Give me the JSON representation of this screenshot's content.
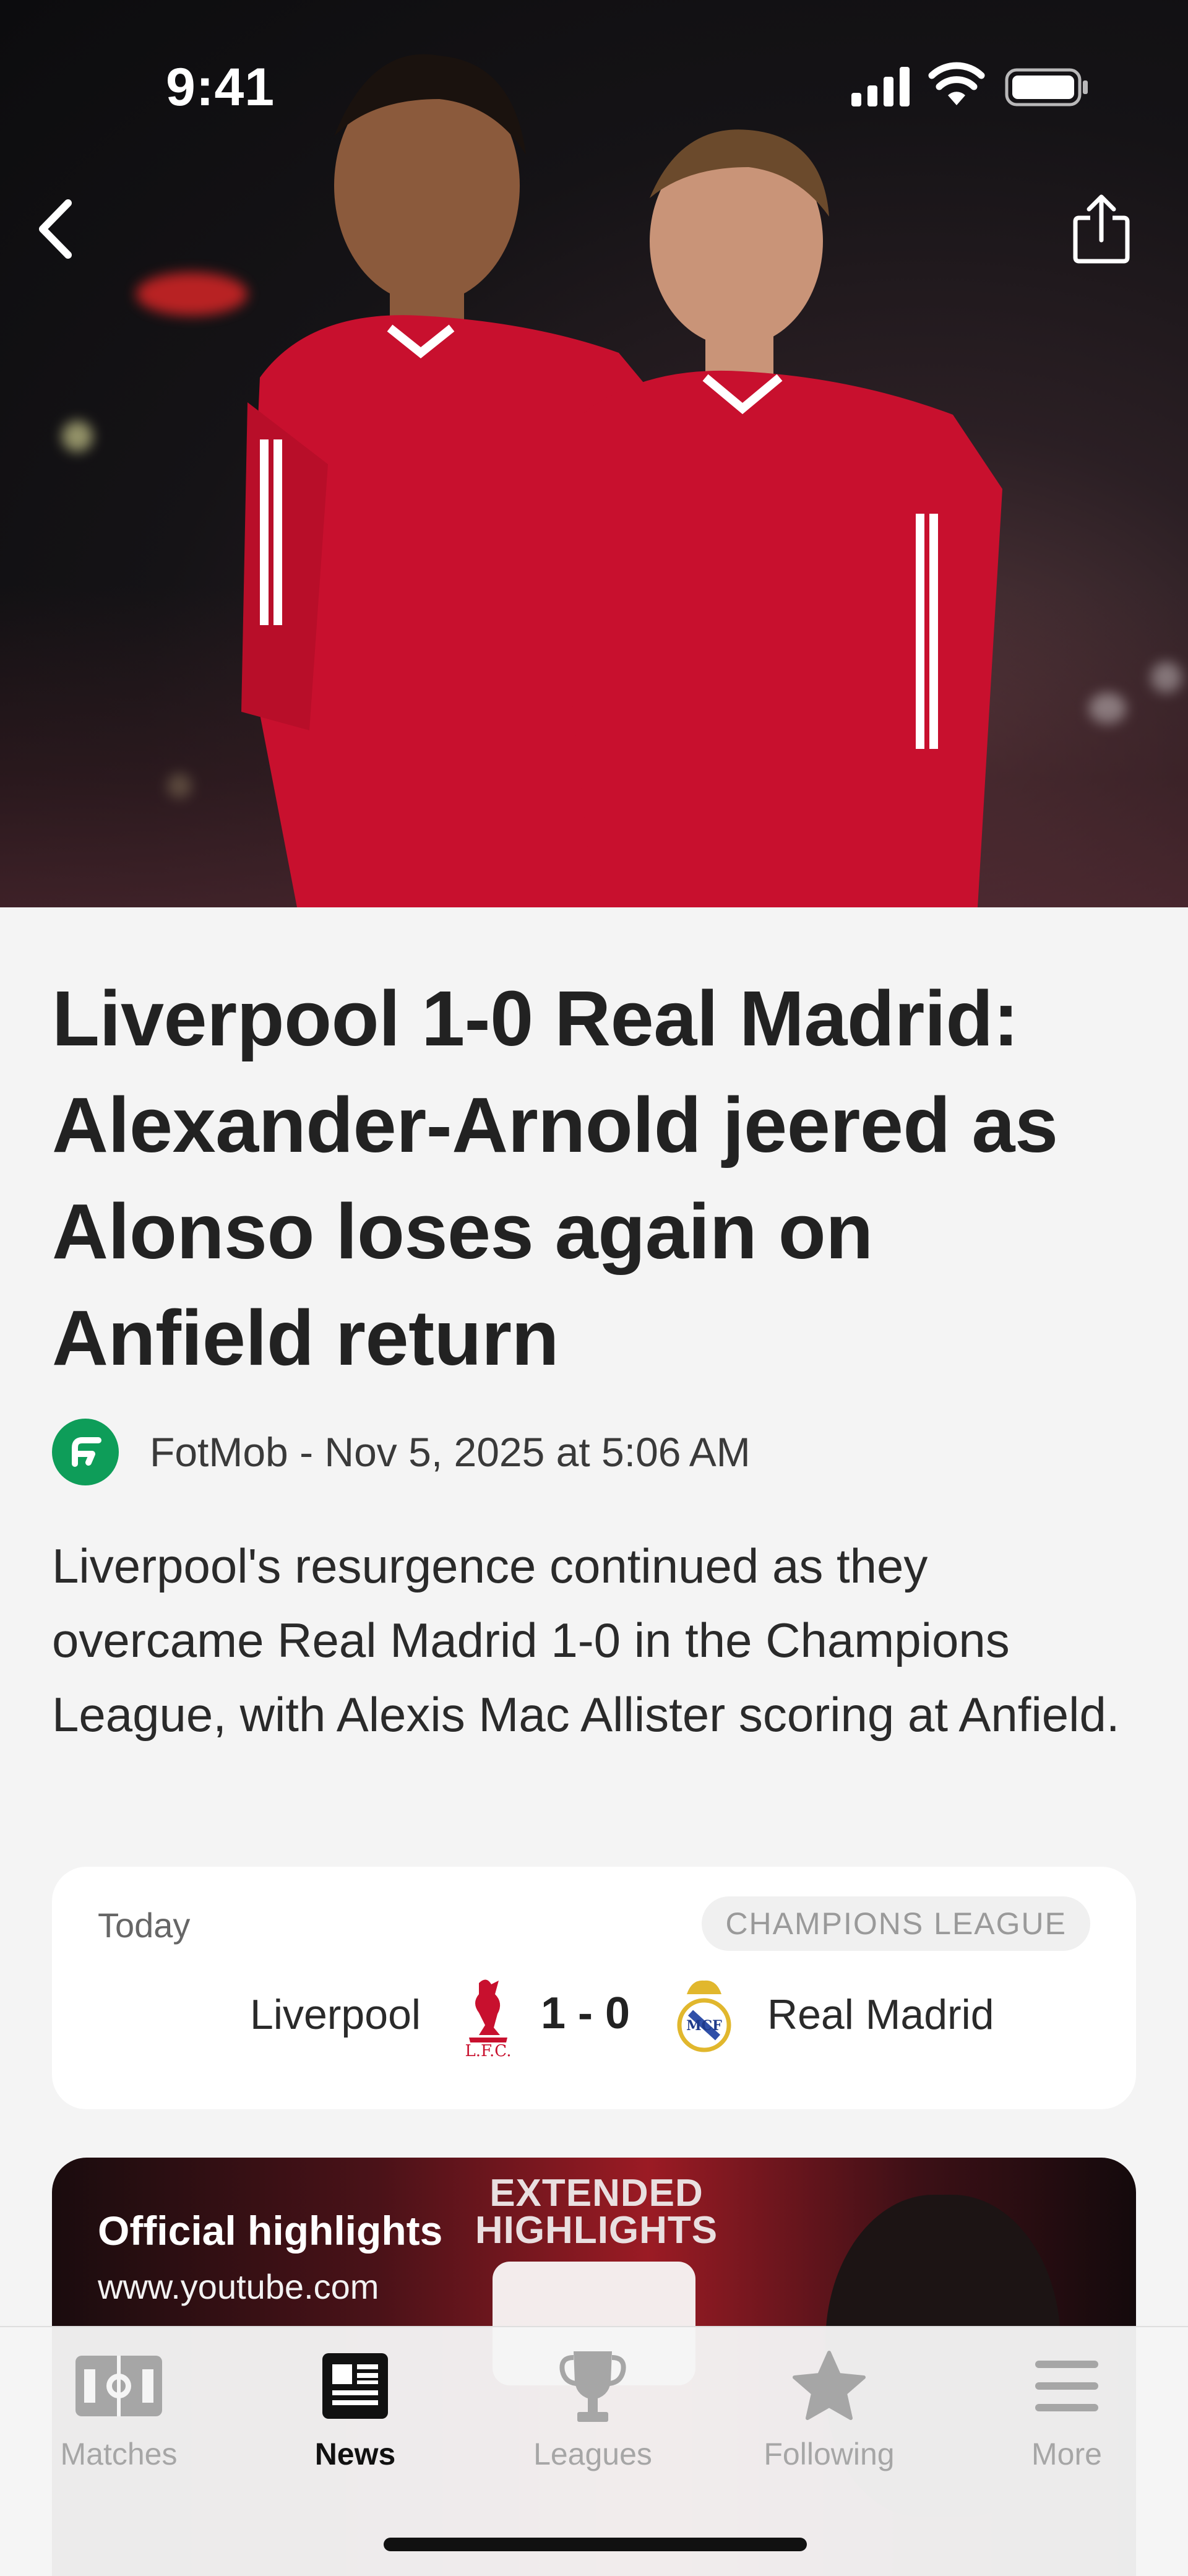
{
  "status_bar": {
    "time": "9:41"
  },
  "article": {
    "title": "Liverpool 1-0 Real Madrid: Alexander-Arnold jeered as Alonso loses again on Anfield return",
    "byline": "FotMob - Nov 5, 2025 at 5:06 AM",
    "summary": "Liverpool's resurgence continued as they overcame Real Madrid 1-0 in the Champions League, with Alexis Mac Allister scoring at Anfield."
  },
  "match": {
    "date": "Today",
    "league": "CHAMPIONS LEAGUE",
    "home_team": "Liverpool",
    "score": "1 - 0",
    "away_team": "Real Madrid",
    "home_crest_icon": "liverpool-crest-icon",
    "away_crest_icon": "real-madrid-crest-icon"
  },
  "video": {
    "title": "Official highlights",
    "source": "www.youtube.com",
    "overlay_text": "EXTENDED HIGHLIGHTS"
  },
  "tabs": [
    {
      "label": "Matches",
      "icon": "pitch-icon"
    },
    {
      "label": "News",
      "icon": "newspaper-icon",
      "active": true
    },
    {
      "label": "Leagues",
      "icon": "trophy-icon"
    },
    {
      "label": "Following",
      "icon": "star-icon"
    },
    {
      "label": "More",
      "icon": "menu-icon"
    }
  ],
  "colors": {
    "brand_green": "#0e9d59",
    "liverpool_red": "#c8102e",
    "active_tab": "#111111",
    "inactive_tab": "#a6a6a6"
  }
}
